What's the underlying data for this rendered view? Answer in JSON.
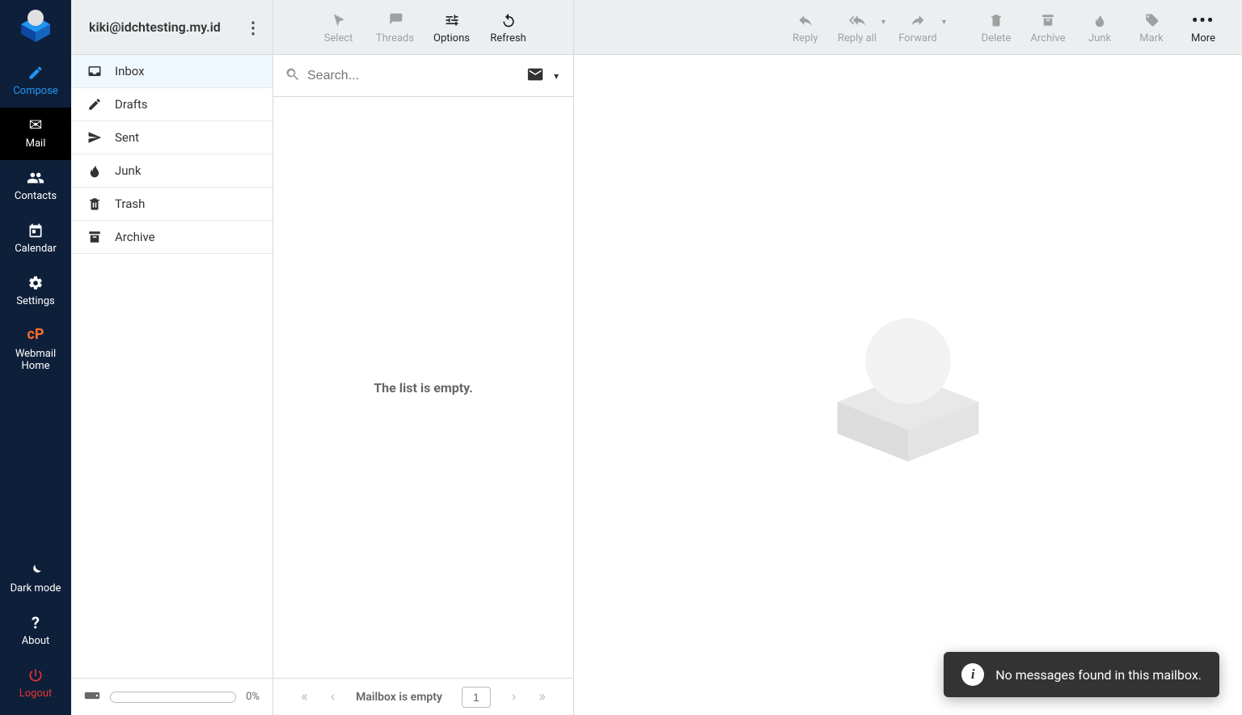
{
  "account_email": "kiki@idchtesting.my.id",
  "taskbar": {
    "compose": "Compose",
    "mail": "Mail",
    "contacts": "Contacts",
    "calendar": "Calendar",
    "settings": "Settings",
    "webmail_home": "Webmail Home",
    "dark_mode": "Dark mode",
    "about": "About",
    "logout": "Logout"
  },
  "folders": [
    {
      "name": "Inbox",
      "selected": true
    },
    {
      "name": "Drafts",
      "selected": false
    },
    {
      "name": "Sent",
      "selected": false
    },
    {
      "name": "Junk",
      "selected": false
    },
    {
      "name": "Trash",
      "selected": false
    },
    {
      "name": "Archive",
      "selected": false
    }
  ],
  "quota_percent": "0%",
  "list_toolbar": {
    "select": "Select",
    "threads": "Threads",
    "options": "Options",
    "refresh": "Refresh"
  },
  "search_placeholder": "Search...",
  "list_empty_text": "The list is empty.",
  "pager": {
    "status": "Mailbox is empty",
    "page": "1"
  },
  "main_toolbar": {
    "reply": "Reply",
    "reply_all": "Reply all",
    "forward": "Forward",
    "delete": "Delete",
    "archive": "Archive",
    "junk": "Junk",
    "mark": "Mark",
    "more": "More"
  },
  "toast_message": "No messages found in this mailbox."
}
